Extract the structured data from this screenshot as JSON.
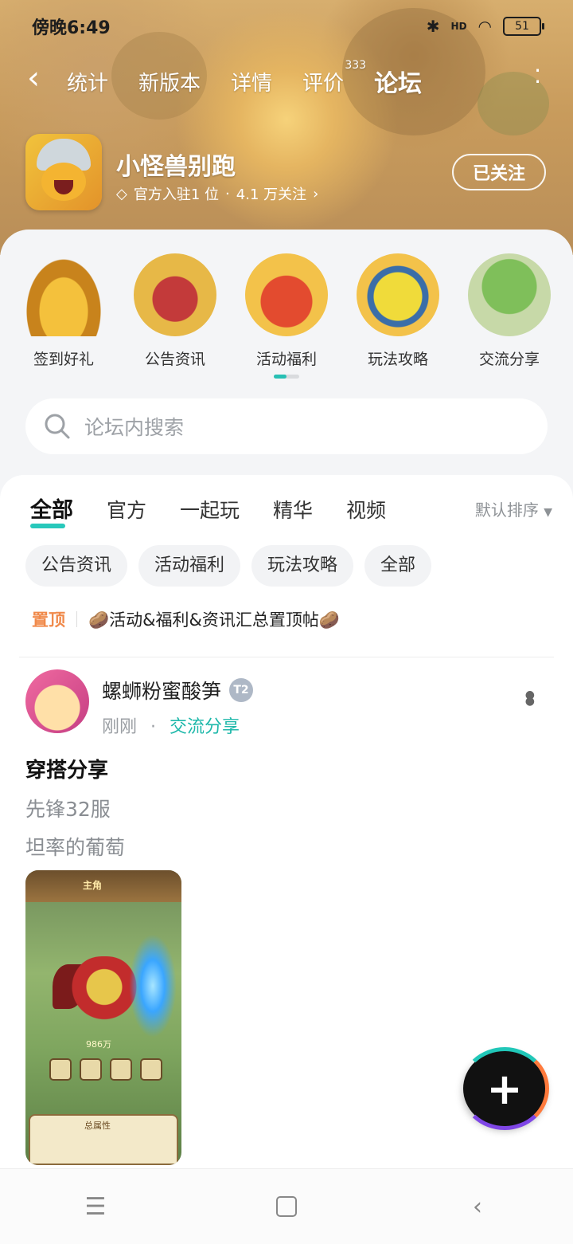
{
  "status_bar": {
    "time": "傍晚6:49",
    "battery": "51",
    "network": "HD"
  },
  "topnav": {
    "tabs": [
      {
        "label": "统计"
      },
      {
        "label": "新版本"
      },
      {
        "label": "详情"
      },
      {
        "label": "评价",
        "count": "333"
      },
      {
        "label": "论坛"
      }
    ],
    "active_tab": "论坛"
  },
  "game": {
    "name": "小怪兽别跑",
    "official_text": "官方入驻1 位",
    "separator": "·",
    "followers": "4.1 万关注",
    "follow_button": "已关注"
  },
  "categories": [
    {
      "label": "签到好礼",
      "icon": "treasure-chest-icon"
    },
    {
      "label": "公告资讯",
      "icon": "king-character-icon"
    },
    {
      "label": "活动福利",
      "icon": "tomato-chef-icon"
    },
    {
      "label": "玩法攻略",
      "icon": "lemon-character-icon"
    },
    {
      "label": "交流分享",
      "icon": "broccoli-character-icon"
    }
  ],
  "search": {
    "placeholder": "论坛内搜索"
  },
  "filter_tabs": [
    {
      "label": "全部"
    },
    {
      "label": "官方"
    },
    {
      "label": "一起玩"
    },
    {
      "label": "精华"
    },
    {
      "label": "视频"
    }
  ],
  "sort_label": "默认排序",
  "chips": [
    {
      "label": "公告资讯"
    },
    {
      "label": "活动福利"
    },
    {
      "label": "玩法攻略"
    },
    {
      "label": "全部"
    }
  ],
  "pinned": {
    "tag": "置顶",
    "title": "🥔活动&福利&资讯汇总置顶帖🥔"
  },
  "post": {
    "author": "螺蛳粉蜜酸笋",
    "badge": "T2",
    "time": "刚刚",
    "dot": "·",
    "section": "交流分享",
    "title": "穿搭分享",
    "line1": "先锋32服",
    "line2": "坦率的葡萄",
    "thumb_header": "主角",
    "thumb_footer": "总属性",
    "thumb_power": "986万"
  },
  "colors": {
    "accent": "#28c8bb",
    "pin_tag": "#f08a4b",
    "section_link": "#1eb8aa"
  }
}
